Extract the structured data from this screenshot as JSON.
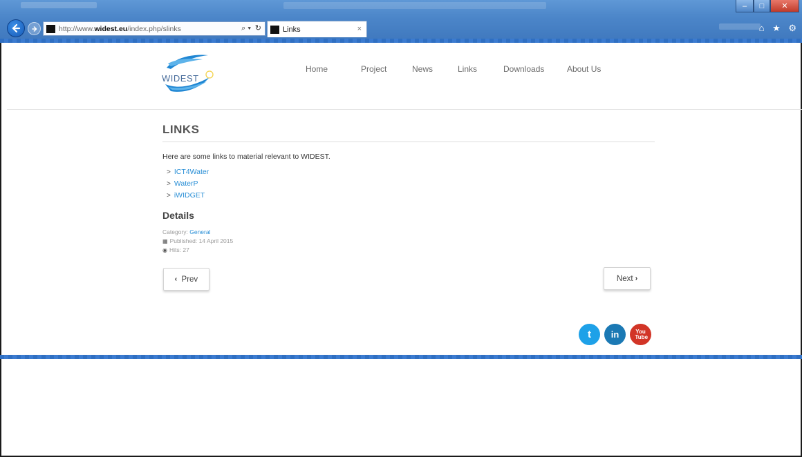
{
  "browser": {
    "address_prefix": "http://www.",
    "address_domain": "widest.eu",
    "address_path": "/index.php/slinks",
    "search_glyph": "⌕ ▾",
    "refresh_glyph": "↻",
    "tab_title": "Links",
    "tab_close": "×",
    "window_controls": [
      "–",
      "□",
      "✕"
    ],
    "toolbar_glyphs": "⌂ ★ ⚙"
  },
  "site": {
    "logo_text": "WIDEST",
    "nav": [
      "Home",
      "Project",
      "News",
      "Links",
      "Downloads",
      "About Us"
    ]
  },
  "article": {
    "title": "LINKS",
    "intro": "Here are some links to material relevant to WIDEST.",
    "links": [
      "ICT4Water",
      "WaterP",
      "iWIDGET"
    ],
    "details_heading": "Details",
    "category_label": "Category:",
    "category_value": "General",
    "published": "Published: 14 April 2015",
    "hits": "Hits: 27"
  },
  "pager": {
    "prev_label": "Prev",
    "next_label": "Next"
  },
  "social": {
    "twitter_glyph": "t",
    "linkedin_glyph": "in",
    "youtube_glyph": "You Tube"
  },
  "colors": {
    "link": "#2a8fd6",
    "chrome_blue": "#4c86c9",
    "twitter": "#1ea1e8",
    "linkedin": "#1b79b4",
    "youtube": "#d23527"
  }
}
